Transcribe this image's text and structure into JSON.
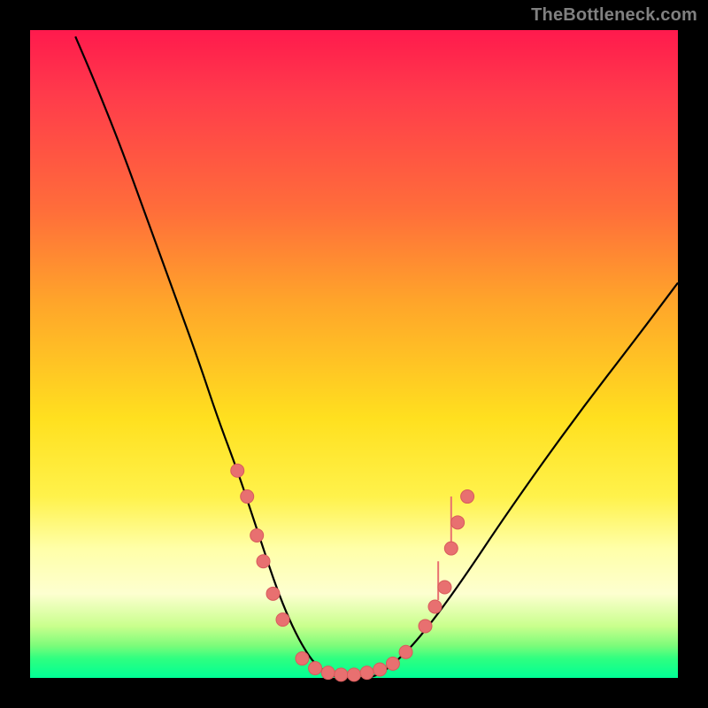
{
  "watermark": "TheBottleneck.com",
  "chart_data": {
    "type": "line",
    "title": "",
    "xlabel": "",
    "ylabel": "",
    "xlim": [
      0,
      100
    ],
    "ylim": [
      0,
      100
    ],
    "grid": false,
    "legend": false,
    "series": [
      {
        "name": "bottleneck-curve",
        "x": [
          7,
          10,
          14,
          18,
          22,
          26,
          29,
          32,
          34,
          36,
          38,
          40,
          42,
          44,
          47,
          50,
          53,
          56,
          60,
          66,
          74,
          84,
          94,
          100
        ],
        "y": [
          99,
          92,
          82,
          71,
          60,
          49,
          40,
          32,
          26,
          20,
          14,
          9,
          5,
          2,
          0,
          0,
          0,
          2,
          6,
          14,
          26,
          40,
          53,
          61
        ]
      }
    ],
    "markers": {
      "name": "sample-points",
      "points": [
        {
          "x": 32,
          "y": 32
        },
        {
          "x": 33.5,
          "y": 28
        },
        {
          "x": 35,
          "y": 22
        },
        {
          "x": 36,
          "y": 18
        },
        {
          "x": 37.5,
          "y": 13
        },
        {
          "x": 39,
          "y": 9
        },
        {
          "x": 42,
          "y": 3
        },
        {
          "x": 44,
          "y": 1.5
        },
        {
          "x": 46,
          "y": 0.8
        },
        {
          "x": 48,
          "y": 0.5
        },
        {
          "x": 50,
          "y": 0.5
        },
        {
          "x": 52,
          "y": 0.8
        },
        {
          "x": 54,
          "y": 1.3
        },
        {
          "x": 56,
          "y": 2.2
        },
        {
          "x": 58,
          "y": 4
        },
        {
          "x": 61,
          "y": 8
        },
        {
          "x": 62.5,
          "y": 11
        },
        {
          "x": 64,
          "y": 14
        },
        {
          "x": 65,
          "y": 20
        },
        {
          "x": 66,
          "y": 24
        },
        {
          "x": 67.5,
          "y": 28
        }
      ]
    },
    "spikes": [
      {
        "x": 63,
        "y0": 12,
        "y1": 18
      },
      {
        "x": 65,
        "y0": 20,
        "y1": 28
      }
    ],
    "colors": {
      "curve": "#000000",
      "markers": "#e87070",
      "gradient_top": "#ff1a4d",
      "gradient_bottom": "#00ff95"
    }
  }
}
